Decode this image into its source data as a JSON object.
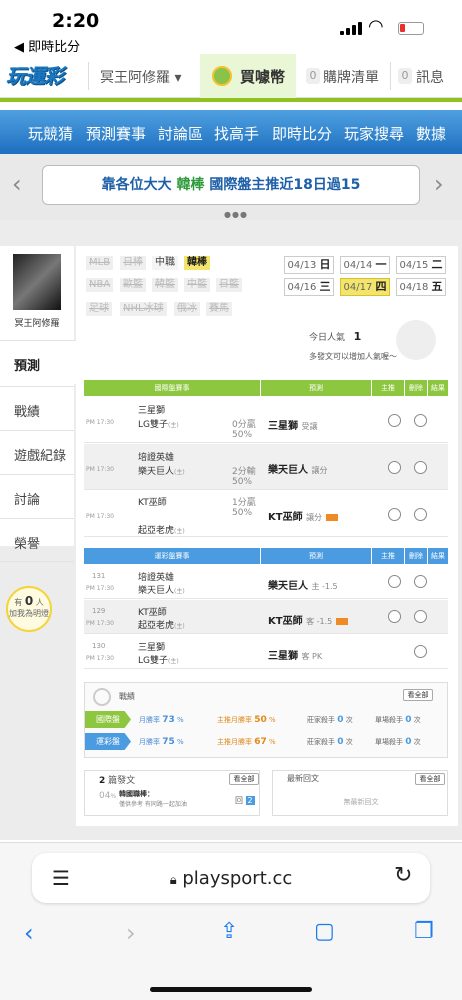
{
  "status_bar": {
    "time": "2:20",
    "back_app": "◀ 即時比分"
  },
  "header": {
    "logo": "玩運彩",
    "user": "冥王阿修羅 ▾",
    "coin_label": "買噱幣",
    "cart_count": "0",
    "cart_label": "購牌清單",
    "msg_count": "0",
    "msg_label": "訊息"
  },
  "nav": [
    "玩競猜",
    "預測賽事",
    "討論區",
    "找高手",
    "即時比分",
    "玩家搜尋",
    "數據"
  ],
  "banner": {
    "pre": "靠各位大大 ",
    "highlight": "韓棒",
    "post": " 國際盤主推近18日過15"
  },
  "sidebar": {
    "name": "冥王阿修羅",
    "items": [
      "預測",
      "戰績",
      "遊戲紀錄",
      "討論",
      "榮譽"
    ],
    "help": {
      "pre": "有",
      "count": "0",
      "post": "人",
      "line2": "加我為明燈"
    }
  },
  "leagues": {
    "row1": [
      "MLB",
      "日棒",
      "中職",
      "韓棒"
    ],
    "row2": [
      "NBA",
      "歐籃",
      "韓籃",
      "中籃",
      "日籃"
    ],
    "row3": [
      "足球",
      "NHL冰球",
      "俄冰",
      "賽馬"
    ]
  },
  "dates": [
    {
      "d": "04/13",
      "w": "日"
    },
    {
      "d": "04/14",
      "w": "一"
    },
    {
      "d": "04/15",
      "w": "二"
    },
    {
      "d": "04/16",
      "w": "三"
    },
    {
      "d": "04/17",
      "w": "四"
    },
    {
      "d": "04/18",
      "w": "五"
    }
  ],
  "popularity": {
    "label": "今日人氣",
    "value": "1",
    "note": "多發文可以增加人氣喔～"
  },
  "table1": {
    "headers": [
      "國際盤賽事",
      "預測",
      "主推",
      "刪除",
      "結果"
    ],
    "rows": [
      {
        "time": "PM 17:30",
        "team1": "三星獅",
        "team2": "LG雙子",
        "tag2": "(主)",
        "odd1": "0分贏",
        "odd2": "50%",
        "pred": "三星獅",
        "pred_type": "受讓"
      },
      {
        "time": "PM 17:30",
        "team1": "培證英雄",
        "team2": "樂天巨人",
        "tag2": "(主)",
        "odd1": "2分輸",
        "odd2": "50%",
        "pred": "樂天巨人",
        "pred_type": "讓分"
      },
      {
        "time": "PM 17:30",
        "team1": "KT巫師",
        "team2": "起亞老虎",
        "tag2": "(主)",
        "odd1": "1分贏",
        "odd2": "50%",
        "pred": "KT巫師",
        "pred_type": "讓分"
      }
    ]
  },
  "table2": {
    "headers": [
      "運彩盤賽事",
      "預測",
      "主推",
      "刪除",
      "結果"
    ],
    "rows": [
      {
        "num": "131",
        "time": "PM 17:30",
        "team1": "培證英雄",
        "team2": "樂天巨人",
        "tag2": "(主)",
        "pred": "樂天巨人",
        "pred_type": "主 -1.5"
      },
      {
        "num": "129",
        "time": "PM 17:30",
        "team1": "KT巫師",
        "team2": "起亞老虎",
        "tag2": "(主)",
        "pred": "KT巫師",
        "pred_type": "客 -1.5"
      },
      {
        "num": "130",
        "time": "PM 17:30",
        "team1": "三星獅",
        "team2": "LG雙子",
        "tag2": "(主)",
        "pred": "三星獅",
        "pred_type": "客 PK"
      }
    ]
  },
  "record": {
    "title": "戰績",
    "view_all": "看全部",
    "rows": [
      {
        "label": "國際盤",
        "month_label": "月勝率",
        "month": "73",
        "main_label": "主推月勝率",
        "main": "50",
        "bank_label": "莊家殺手",
        "bank": "0",
        "single_label": "單場殺手",
        "single": "0",
        "unit": "次",
        "color": "#8dc63f"
      },
      {
        "label": "運彩盤",
        "month_label": "月勝率",
        "month": "75",
        "main_label": "主推月勝率",
        "main": "67",
        "bank_label": "莊家殺手",
        "bank": "0",
        "single_label": "單場殺手",
        "single": "0",
        "unit": "次",
        "color": "#4a9be0"
      }
    ]
  },
  "posts": {
    "count": "2",
    "label": "篇發文",
    "view_all": "看全部",
    "date": "04",
    "date_unit": "%",
    "title": "韓國職棒：",
    "excerpt": "僅供參考 有同路一起加油",
    "reply": "2",
    "replies_label": "回"
  },
  "replies": {
    "label": "最新回文",
    "view_all": "看全部",
    "empty": "無最新回文"
  },
  "browser": {
    "url": "playsport.cc"
  },
  "colors": {
    "green": "#8dc63f",
    "blue": "#4a9be0",
    "nav_blue": "#1d6fc0",
    "highlight": "#f3e46b"
  }
}
